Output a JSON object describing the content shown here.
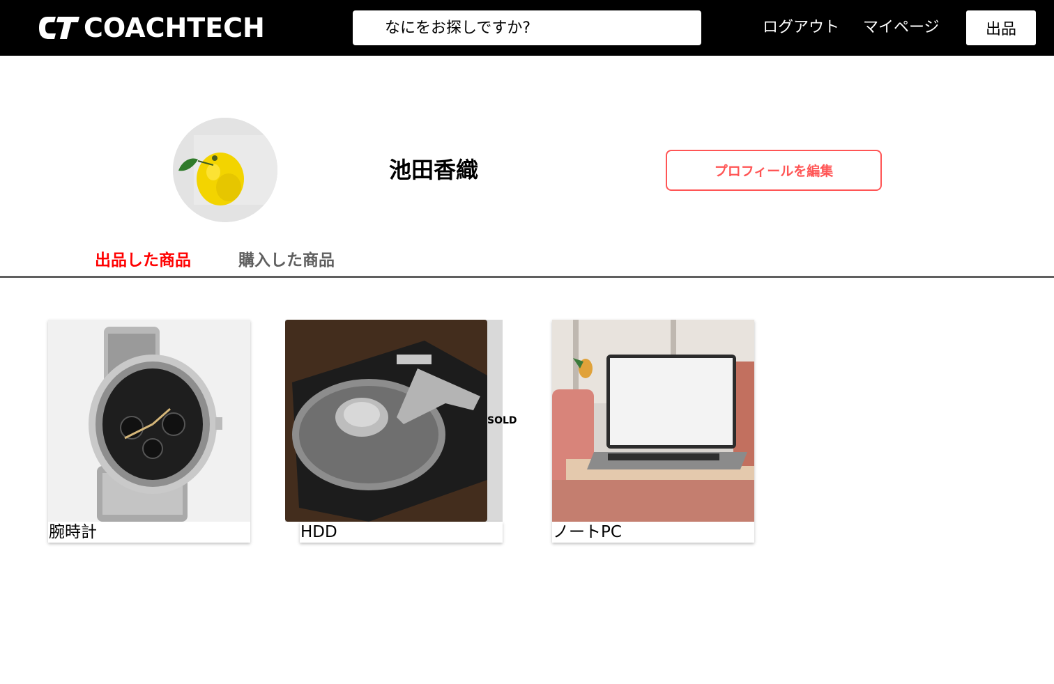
{
  "header": {
    "logo_text": "COACHTECH",
    "search_placeholder": "なにをお探しですか?",
    "logout_label": "ログアウト",
    "mypage_label": "マイページ",
    "sell_label": "出品"
  },
  "profile": {
    "username": "池田香織",
    "edit_button_label": "プロフィールを編集"
  },
  "tabs": [
    {
      "label": "出品した商品",
      "active": true
    },
    {
      "label": "購入した商品",
      "active": false
    }
  ],
  "products": [
    {
      "name": "腕時計",
      "sold": false
    },
    {
      "name": "HDD",
      "sold": true,
      "sold_label": "SOLD"
    },
    {
      "name": "ノートPC",
      "sold": false
    }
  ],
  "colors": {
    "header_bg": "#000000",
    "accent_red": "#ff0000",
    "edit_button": "#ff5555",
    "inactive_tab": "#5f5f5f"
  },
  "icons": {
    "logo": "coachtech-logo-mark",
    "avatar": "yuzu-fruit-photo"
  }
}
